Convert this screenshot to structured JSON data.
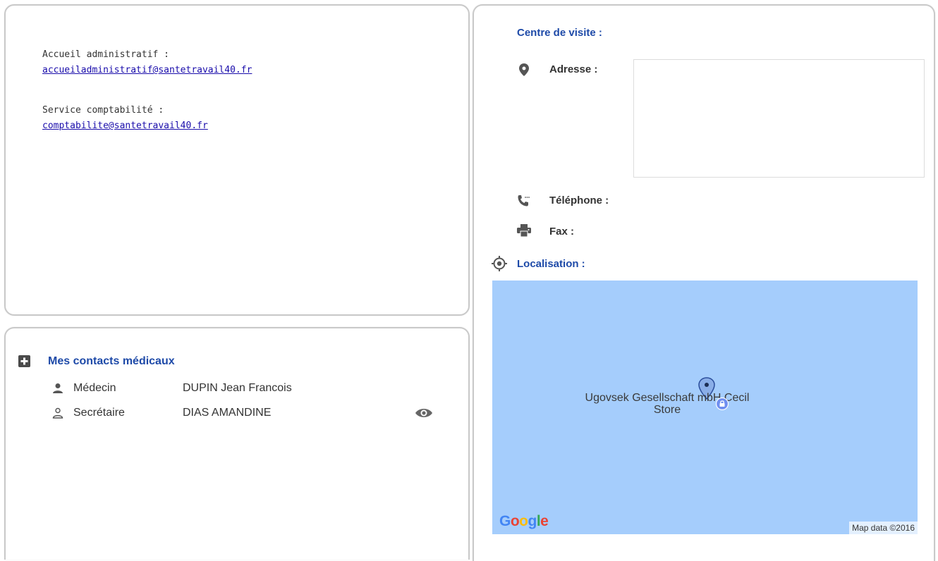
{
  "admin": {
    "accueil_label": "Accueil administratif :",
    "accueil_email": "accueiladministratif@santetravail40.fr",
    "compta_label": "Service comptabilité :",
    "compta_email": "comptabilite@santetravail40.fr"
  },
  "medical": {
    "title": "Mes contacts médicaux",
    "contacts": [
      {
        "role": "Médecin",
        "name": "DUPIN Jean Francois"
      },
      {
        "role": "Secrétaire",
        "name": "DIAS AMANDINE"
      }
    ]
  },
  "visit": {
    "title": "Centre de visite :",
    "address_label": "Adresse :",
    "address_value": "",
    "phone_label": "Téléphone :",
    "fax_label": "Fax :",
    "location_title": "Localisation :"
  },
  "map": {
    "place_name": "Ugovsek Gesellschaft mbH Cecil Store",
    "credit": "Map data ©2016",
    "logo": "Google"
  },
  "colors": {
    "accent_blue": "#1e4aa8",
    "link": "#1a0dab",
    "map_water": "#a5cdfc"
  },
  "icons": {
    "medical": "plus-square-icon",
    "doctor": "user-filled-icon",
    "secretary": "user-outline-icon",
    "view": "eye-icon",
    "address": "map-pin-icon",
    "phone": "phone-icon",
    "fax": "printer-icon",
    "location": "crosshair-icon"
  }
}
